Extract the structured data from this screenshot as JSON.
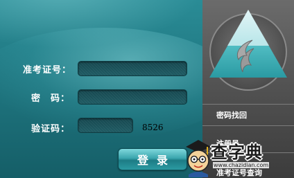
{
  "form": {
    "exam_id_label": "准考证号：",
    "password_label": "密　码：",
    "captcha_label": "验证码：",
    "exam_id_value": "",
    "password_value": "",
    "captcha_value": "",
    "captcha_code": "8526",
    "login_label": "登录"
  },
  "sidebar": {
    "links": [
      {
        "label": "密码找回"
      },
      {
        "label": "注册号"
      },
      {
        "label": "准考证号查询"
      }
    ]
  },
  "watermark": {
    "title": "查字典",
    "url": "www.chazidian.com"
  },
  "colors": {
    "panel_teal": "#1f7680",
    "sidebar_gray": "#555555",
    "logo_teal": "#3fb6bd"
  }
}
